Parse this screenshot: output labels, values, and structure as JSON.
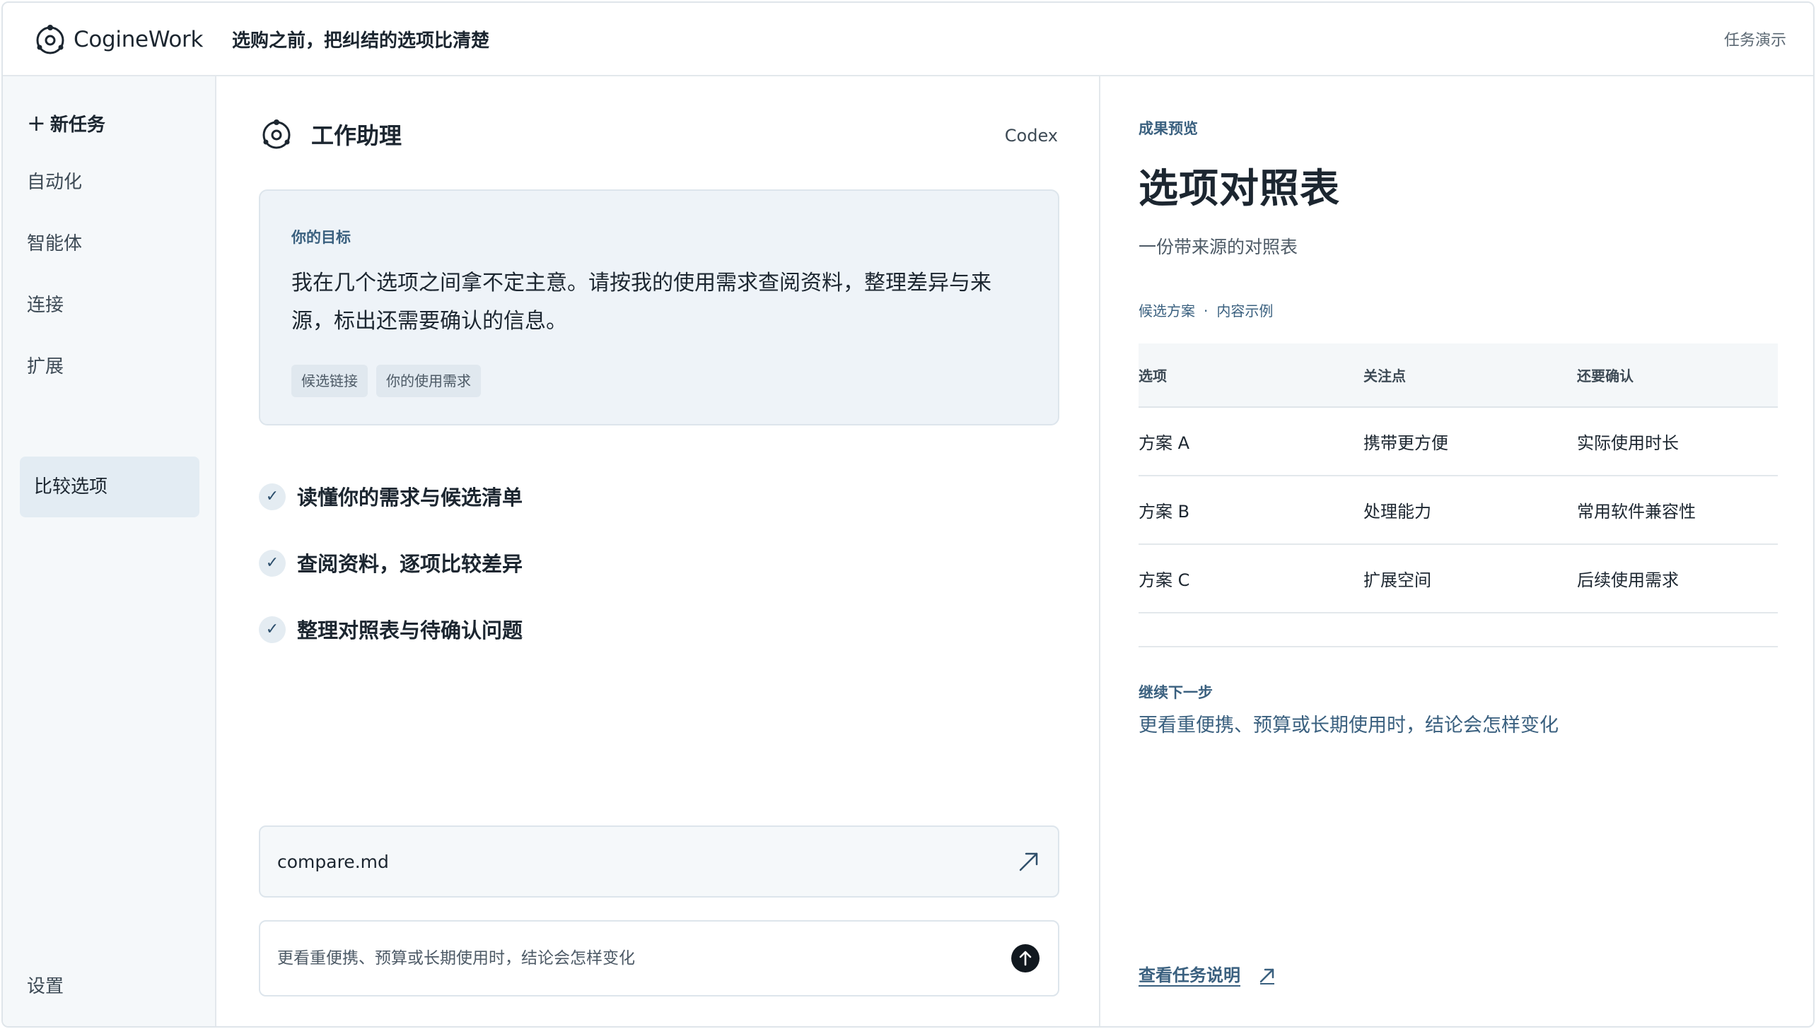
{
  "app": {
    "brand": "CogineWork",
    "page_heading": "选购之前，把纠结的选项比清楚",
    "task_demo": "任务演示",
    "logo_icon": "orbit-logo-icon"
  },
  "sidebar": {
    "new_task": "新任务",
    "items": [
      {
        "label": "自动化"
      },
      {
        "label": "智能体"
      },
      {
        "label": "连接"
      },
      {
        "label": "扩展"
      }
    ],
    "active_item": "比较选项",
    "settings": "设置"
  },
  "assistant": {
    "title": "工作助理",
    "model": "Codex",
    "goal": {
      "label": "你的目标",
      "text": "我在几个选项之间拿不定主意。请按我的使用需求查阅资料，整理差异与来源，标出还需要确认的信息。",
      "chips": [
        "候选链接",
        "你的使用需求"
      ]
    },
    "steps": [
      {
        "label": "读懂你的需求与候选清单",
        "status": "done"
      },
      {
        "label": "查阅资料，逐项比较差异",
        "status": "done"
      },
      {
        "label": "整理对照表与待确认问题",
        "status": "done"
      }
    ],
    "file": {
      "name": "compare.md",
      "icon": "arrow-up-right-icon"
    },
    "prompt": {
      "placeholder": "更看重便携、预算或长期使用时，结论会怎样变化"
    }
  },
  "preview": {
    "label": "成果预览",
    "title": "选项对照表",
    "subtitle": "一份带来源的对照表",
    "source_note": {
      "left": "候选方案",
      "sep": "·",
      "right": "内容示例"
    },
    "table": {
      "headers": [
        "选项",
        "关注点",
        "还要确认"
      ],
      "rows": [
        [
          "方案 A",
          "携带更方便",
          "实际使用时长"
        ],
        [
          "方案 B",
          "处理能力",
          "常用软件兼容性"
        ],
        [
          "方案 C",
          "扩展空间",
          "后续使用需求"
        ]
      ]
    },
    "next": {
      "label": "继续下一步",
      "text": "更看重便携、预算或长期使用时，结论会怎样变化"
    },
    "task_link": "查看任务说明"
  },
  "colors": {
    "accent": "#3a607f",
    "sidebar_bg": "#f5f8fa",
    "active_bg": "#e3ecf3",
    "goal_card_bg": "#eef3f8",
    "send_button": "#11181f"
  }
}
